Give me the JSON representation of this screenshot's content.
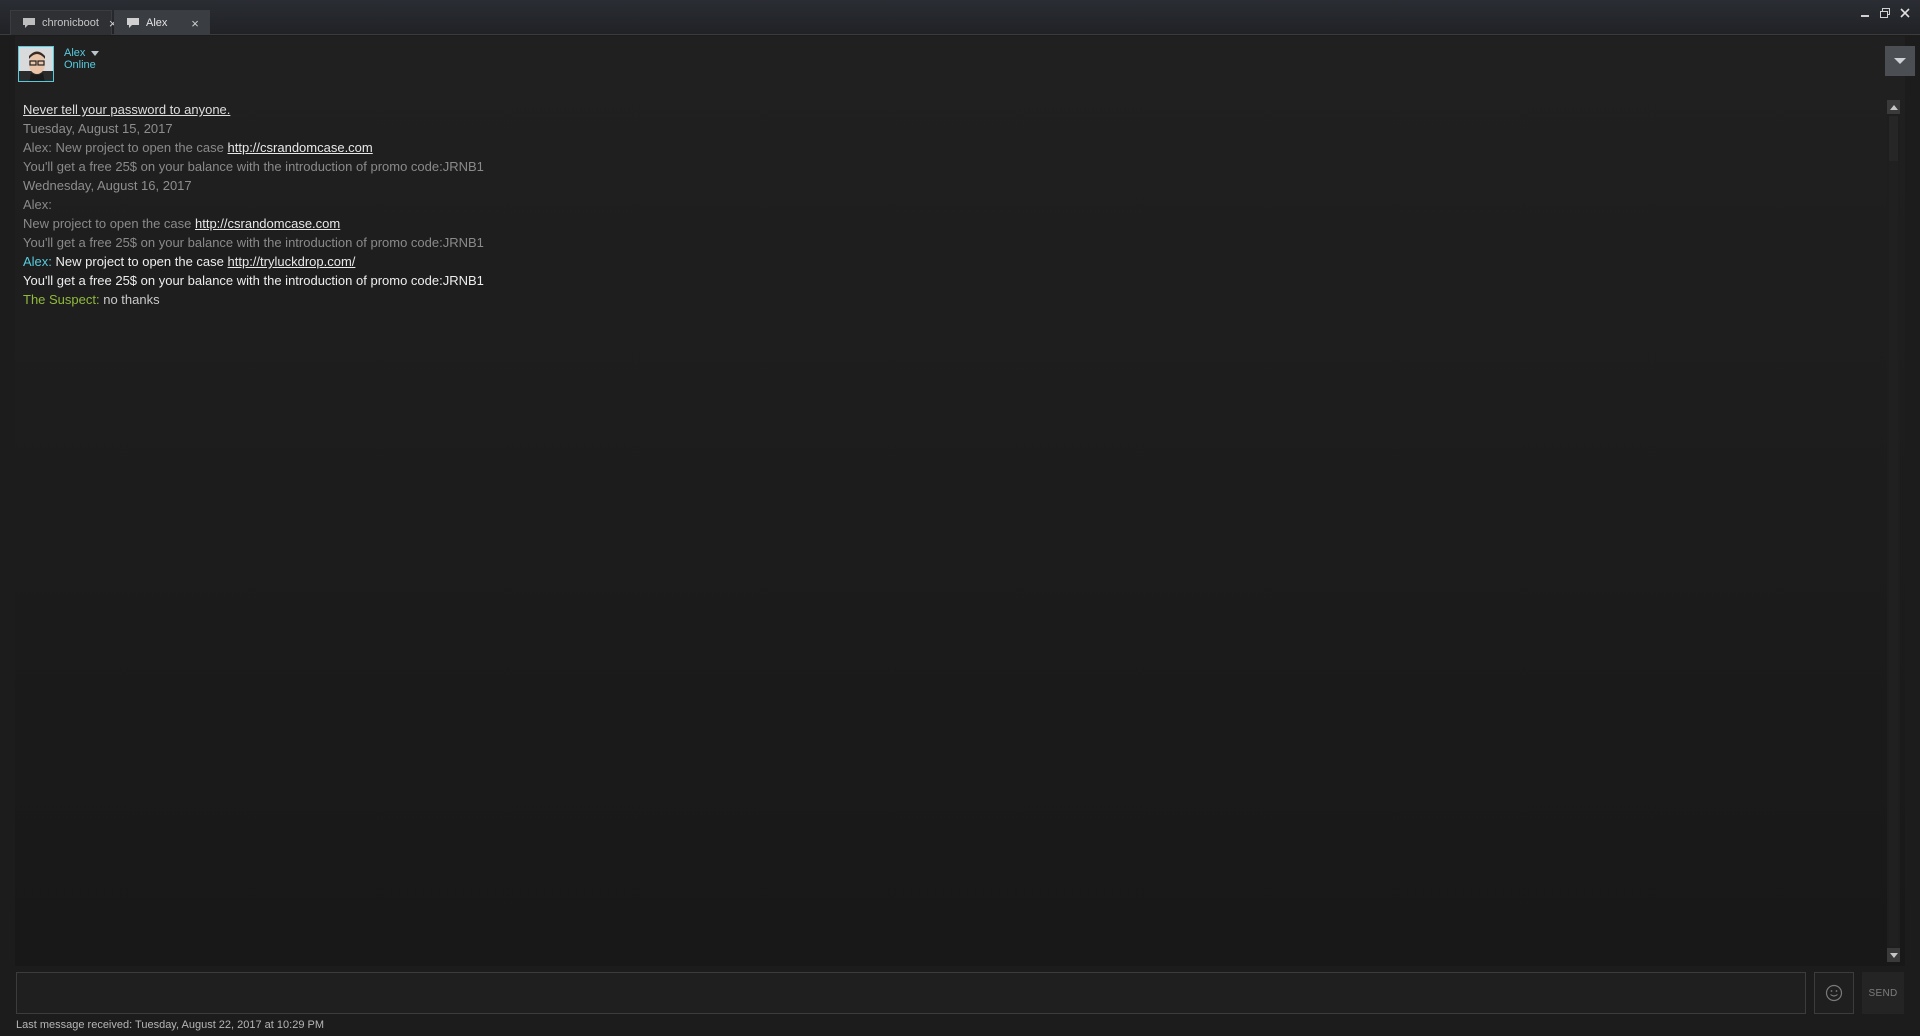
{
  "tabs": [
    {
      "label": "chronicboot",
      "active": false
    },
    {
      "label": "Alex",
      "active": true
    }
  ],
  "header": {
    "friend_name": "Alex",
    "friend_status": "Online"
  },
  "messages": {
    "warning": "Never tell your password to anyone.",
    "date1": "Tuesday, August 15, 2017",
    "m1_sender": "Alex:",
    "m1_text": " New project to open the case ",
    "m1_link": "http://csrandomcase.com",
    "m2_text": "You'll get a free 25$ on your balance with the introduction of promo code:JRNB1",
    "date2": "Wednesday, August 16, 2017",
    "m3_sender": "Alex:",
    "m4_text": "New project to open the case ",
    "m4_link": "http://csrandomcase.com",
    "m5_text": "You'll get a free 25$ on your balance with the introduction of promo code:JRNB1",
    "m6_sender": "Alex:",
    "m6_text": " New project to open the case ",
    "m6_link": "http://tryluckdrop.com/",
    "m7_text": "You'll get a free 25$ on your balance with the introduction of promo code:JRNB1",
    "m8_sender": "The Suspect:",
    "m8_text": " no thanks"
  },
  "input": {
    "value": "",
    "send_label": "SEND"
  },
  "footer": {
    "last_message": "Last message received: Tuesday, August 22, 2017 at 10:29 PM"
  },
  "colors": {
    "friend_accent": "#57cbde",
    "self_accent": "#90ba3c",
    "background": "#1c1c1c"
  },
  "icons": [
    "chat-bubble-icon",
    "close-icon",
    "minimize-icon",
    "maximize-icon",
    "dropdown-caret-icon",
    "emoticon-icon",
    "scroll-up-icon",
    "scroll-down-icon"
  ]
}
